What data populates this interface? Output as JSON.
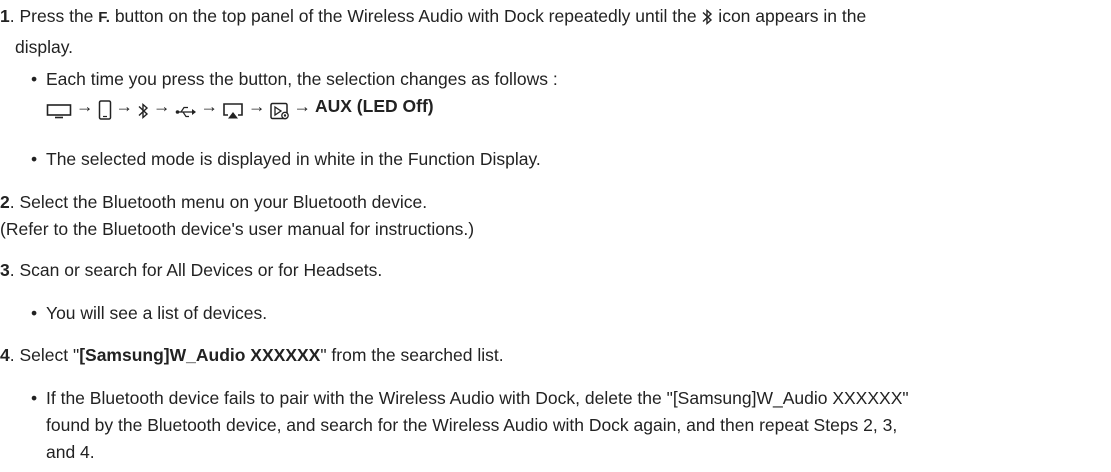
{
  "steps": [
    {
      "num": "1",
      "text_a": "Press the ",
      "button_label": "F.",
      "text_b": " button on the top panel of the Wireless Audio with Dock repeatedly until the ",
      "text_c": " icon appears in the",
      "text_d": "display.",
      "bullets": [
        {
          "text": "Each time you press the button, the selection changes as follows :",
          "sequence": [
            "tv-icon",
            "phone-icon",
            "bluetooth-icon",
            "usb-icon",
            "airplay-icon",
            "allshare-icon"
          ],
          "sequence_end": "AUX (LED Off)"
        },
        {
          "text": "The selected mode is displayed in white in the Function Display."
        }
      ]
    },
    {
      "num": "2",
      "line1": "Select the Bluetooth menu on your Bluetooth device.",
      "line2": "(Refer to the Bluetooth device's user manual for instructions.)"
    },
    {
      "num": "3",
      "line1": "Scan or search for All Devices or for Headsets.",
      "bullets": [
        {
          "text": "You will see a list of devices."
        }
      ]
    },
    {
      "num": "4",
      "text_a": "Select \"",
      "device_name": "[Samsung]W_Audio XXXXXX",
      "text_b": "\" from the searched list.",
      "bullets": [
        {
          "line1": "If the Bluetooth device fails to pair with the Wireless Audio with Dock, delete the \"[Samsung]W_Audio XXXXXX\"",
          "line2": "found by the Bluetooth device, and search for the Wireless Audio with Dock again, and then repeat Steps 2, 3,",
          "line3": "and 4."
        }
      ]
    }
  ],
  "arrow_glyph": "→",
  "bullet_glyph": "•"
}
